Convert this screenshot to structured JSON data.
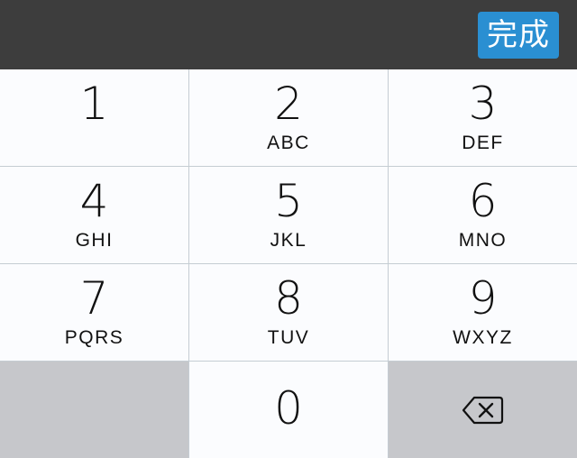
{
  "toolbar": {
    "done_label": "完成",
    "accent_color": "#2a8fd2",
    "background_color": "#3d3d3d"
  },
  "keypad": {
    "keys": [
      {
        "digit": "1",
        "letters": ""
      },
      {
        "digit": "2",
        "letters": "ABC"
      },
      {
        "digit": "3",
        "letters": "DEF"
      },
      {
        "digit": "4",
        "letters": "GHI"
      },
      {
        "digit": "5",
        "letters": "JKL"
      },
      {
        "digit": "6",
        "letters": "MNO"
      },
      {
        "digit": "7",
        "letters": "PQRS"
      },
      {
        "digit": "8",
        "letters": "TUV"
      },
      {
        "digit": "9",
        "letters": "WXYZ"
      },
      {
        "digit": "0",
        "letters": ""
      }
    ],
    "backspace_icon": "backspace-icon",
    "key_color": "#fbfcfe",
    "function_key_color": "#c6c7cb"
  }
}
